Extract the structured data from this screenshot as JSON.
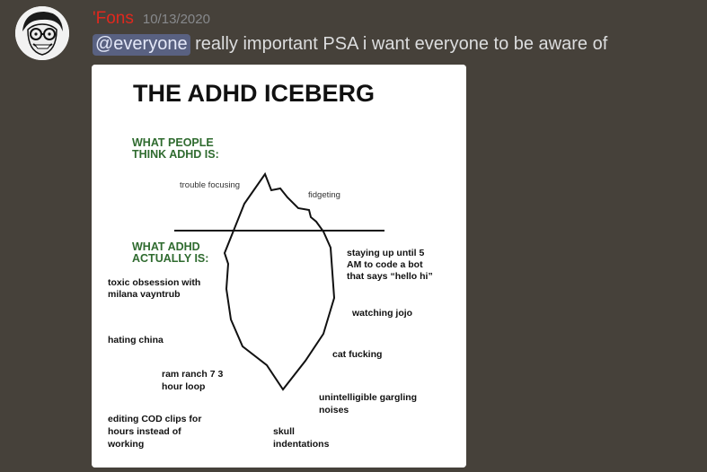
{
  "message": {
    "username": "'Fons",
    "timestamp": "10/13/2020",
    "mention": "@everyone",
    "text": " really important PSA i want everyone to be aware of"
  },
  "image": {
    "title": "THE ADHD ICEBERG",
    "above_heading": [
      "WHAT PEOPLE",
      "THINK ADHD IS:"
    ],
    "below_heading": [
      "WHAT ADHD",
      "ACTUALLY IS:"
    ],
    "above_items": {
      "trouble_focusing": "trouble focusing",
      "fidgeting": "fidgeting"
    },
    "below_items": {
      "toxic_obsession": [
        "toxic obsession with",
        "milana vayntrub"
      ],
      "staying_up": [
        "staying up until 5",
        "AM to code a bot",
        "that says “hello hi”"
      ],
      "watching_jojo": "watching jojo",
      "hating_china": "hating china",
      "cat_fucking": "cat fucking",
      "ram_ranch": [
        "ram ranch 7 3",
        "hour loop"
      ],
      "gargling": [
        "unintelligible gargling",
        "noises"
      ],
      "editing_cod": [
        "editing COD clips for",
        "hours instead of",
        "working"
      ],
      "skull": [
        "skull",
        "indentations"
      ]
    }
  },
  "colors": {
    "username": "#e0281e",
    "background": "#46413a",
    "mention_bg": "#5a6596",
    "heading_green": "#2f6b2f"
  }
}
